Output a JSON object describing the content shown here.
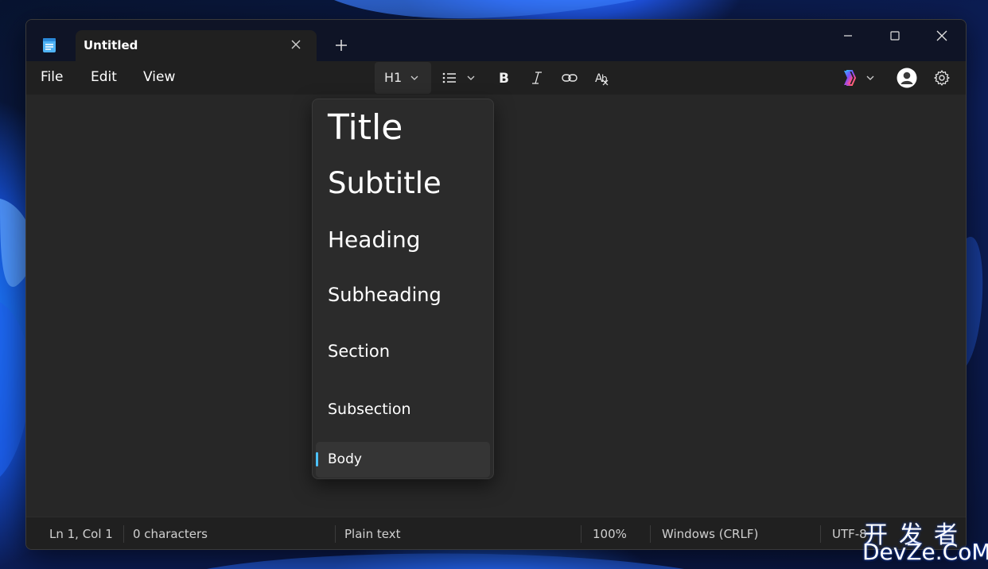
{
  "window": {
    "tab_title": "Untitled"
  },
  "menu": {
    "file": "File",
    "edit": "Edit",
    "view": "View"
  },
  "toolbar": {
    "heading_value": "H1",
    "icons": [
      "chevron-down-icon",
      "bulleted-list-icon",
      "bold-icon",
      "italic-icon",
      "link-icon",
      "clear-formatting-icon",
      "copilot-icon",
      "account-icon",
      "settings-icon"
    ]
  },
  "heading_menu": {
    "items": [
      "Title",
      "Subtitle",
      "Heading",
      "Subheading",
      "Section",
      "Subsection",
      "Body"
    ],
    "selected": "Body"
  },
  "status": {
    "position": "Ln 1, Col 1",
    "characters": "0 characters",
    "format": "Plain text",
    "zoom": "100%",
    "line_endings": "Windows (CRLF)",
    "encoding": "UTF-8"
  },
  "watermark": {
    "cn": "开发者",
    "en": "DevZe.CoM"
  },
  "colors": {
    "accent": "#4cc2ff",
    "window_bg": "#202020",
    "editor_bg": "#272727",
    "menu_bg": "#2b2b2b"
  }
}
